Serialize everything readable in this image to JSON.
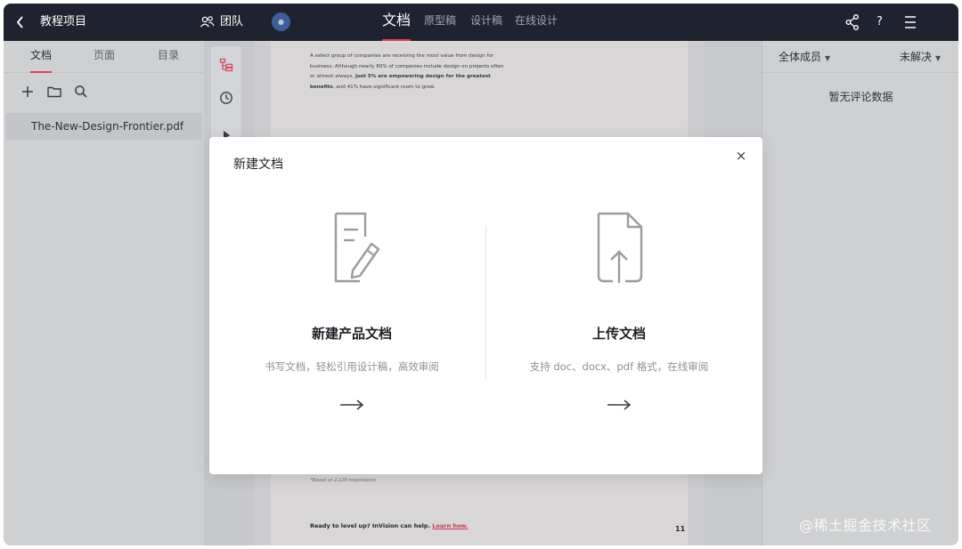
{
  "topbar": {
    "project_name": "教程项目",
    "team_label": "团队",
    "avatar_text": "●",
    "tabs": [
      {
        "label": "文档",
        "active": true
      },
      {
        "label": "原型稿",
        "active": false
      },
      {
        "label": "设计稿",
        "active": false
      },
      {
        "label": "在线设计",
        "active": false
      }
    ],
    "help_label": "?",
    "accent_color": "#e23f55",
    "icons": [
      "back-icon",
      "team-icon",
      "share-icon",
      "help-icon",
      "menu-icon"
    ]
  },
  "left_panel": {
    "tabs": [
      {
        "label": "文档",
        "active": true
      },
      {
        "label": "页面",
        "active": false
      },
      {
        "label": "目录",
        "active": false
      }
    ],
    "toolbar_icons": [
      "plus-icon",
      "folder-icon",
      "search-icon"
    ],
    "files": [
      {
        "name": "The-New-Design-Frontier.pdf",
        "selected": true
      }
    ]
  },
  "tool_strip": {
    "icons": [
      "outline-icon",
      "history-icon",
      "play-icon"
    ]
  },
  "document": {
    "para_part1": "A select group of companies are receiving the most value from design for business. Although nearly 80% of companies include design on projects often or almost always, ",
    "para_bold": "just 5% are empowering design for the greatest benefits",
    "para_part2": ", and 41% have significant room to grow.",
    "footnote": "*Based on 2,229 respondents",
    "cta_text": "Ready to level up? InVision can help. ",
    "cta_link": "Learn how.",
    "page_number": "11"
  },
  "right_panel": {
    "member_filter": "全体成员",
    "status_filter": "未解决",
    "empty_text": "暂无评论数据"
  },
  "modal": {
    "title": "新建文档",
    "close_label": "×",
    "options": [
      {
        "title": "新建产品文档",
        "desc": "书写文档，轻松引用设计稿，高效审阅",
        "icon": "document-edit-icon"
      },
      {
        "title": "上传文档",
        "desc": "支持 doc、docx、pdf 格式，在线审阅",
        "icon": "document-upload-icon"
      }
    ]
  },
  "watermark": "@稀土掘金技术社区"
}
